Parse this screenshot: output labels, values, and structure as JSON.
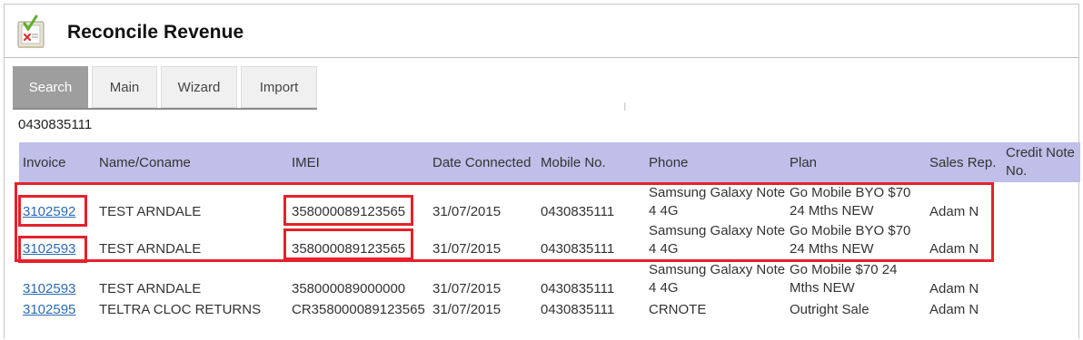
{
  "header": {
    "title": "Reconcile Revenue",
    "icon": "checklist-icon"
  },
  "tabs": [
    {
      "label": "Search",
      "active": true
    },
    {
      "label": "Main",
      "active": false
    },
    {
      "label": "Wizard",
      "active": false
    },
    {
      "label": "Import",
      "active": false
    }
  ],
  "search": {
    "value": "0430835111"
  },
  "table": {
    "columns": {
      "invoice": "Invoice",
      "name": "Name/Coname",
      "imei": "IMEI",
      "date": "Date Connected",
      "mobile": "Mobile No.",
      "phone": "Phone",
      "plan": "Plan",
      "rep": "Sales Rep.",
      "credit_1": "Credit Note",
      "credit_2": "No."
    },
    "rows": [
      {
        "invoice": "3102592",
        "name": "TEST ARNDALE",
        "imei": "358000089123565",
        "date": "31/07/2015",
        "mobile": "0430835111",
        "phone_1": "Samsung Galaxy Note",
        "phone_2": "4 4G",
        "plan_1": "Go Mobile BYO $70",
        "plan_2": "24 Mths NEW",
        "rep": "Adam N",
        "credit": ""
      },
      {
        "invoice": "3102593",
        "name": "TEST ARNDALE",
        "imei": "358000089123565",
        "date": "31/07/2015",
        "mobile": "0430835111",
        "phone_1": "Samsung Galaxy Note",
        "phone_2": "4 4G",
        "plan_1": "Go Mobile BYO $70",
        "plan_2": "24 Mths NEW",
        "rep": "Adam N",
        "credit": ""
      },
      {
        "invoice": "3102593",
        "name": "TEST ARNDALE",
        "imei": "358000089000000",
        "date": "31/07/2015",
        "mobile": "0430835111",
        "phone_1": "Samsung Galaxy Note",
        "phone_2": "4 4G",
        "plan_1": "Go Mobile $70 24",
        "plan_2": "Mths NEW",
        "rep": "Adam N",
        "credit": ""
      },
      {
        "invoice": "3102595",
        "name": "TELTRA CLOC RETURNS",
        "imei": "CR358000089123565",
        "date": "31/07/2015",
        "mobile": "0430835111",
        "phone_1": "CRNOTE",
        "phone_2": "",
        "plan_1": "Outright Sale",
        "plan_2": "",
        "rep": "Adam N",
        "credit": ""
      }
    ]
  },
  "colors": {
    "header_bg": "#c0bfe9",
    "highlight": "#e5212b",
    "link": "#2a6ab8",
    "active_tab": "#9e9e9e"
  }
}
